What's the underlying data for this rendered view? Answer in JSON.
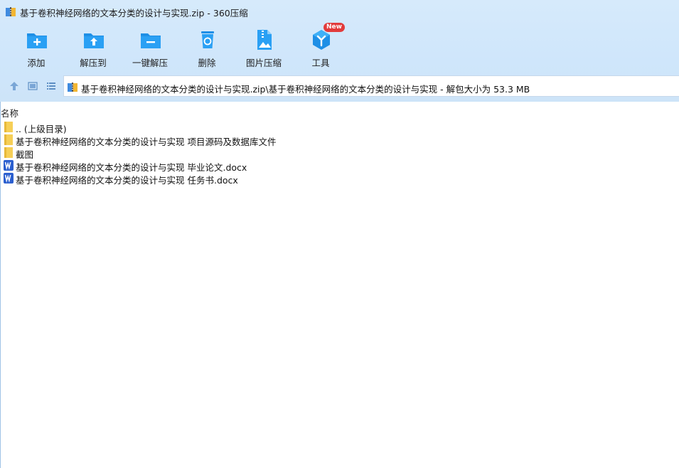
{
  "window": {
    "title": "基于卷积神经网络的文本分类的设计与实现.zip - 360压缩"
  },
  "toolbar": {
    "items": [
      {
        "label": "添加",
        "icon": "folder-plus-icon"
      },
      {
        "label": "解压到",
        "icon": "folder-upload-icon"
      },
      {
        "label": "一键解压",
        "icon": "folder-minus-icon"
      },
      {
        "label": "删除",
        "icon": "recycle-bin-icon"
      },
      {
        "label": "图片压缩",
        "icon": "image-compress-icon"
      },
      {
        "label": "工具",
        "icon": "tools-cube-icon",
        "badge": "New"
      }
    ]
  },
  "address": {
    "path": "基于卷积神经网络的文本分类的设计与实现.zip\\基于卷积神经网络的文本分类的设计与实现 - 解包大小为 53.3 MB"
  },
  "filelist": {
    "header": "名称",
    "rows": [
      {
        "name": ".. (上级目录)",
        "type": "folder"
      },
      {
        "name": "基于卷积神经网络的文本分类的设计与实现 项目源码及数据库文件",
        "type": "folder"
      },
      {
        "name": "截图",
        "type": "folder"
      },
      {
        "name": "基于卷积神经网络的文本分类的设计与实现 毕业论文.docx",
        "type": "word"
      },
      {
        "name": "基于卷积神经网络的文本分类的设计与实现 任务书.docx",
        "type": "word"
      }
    ]
  },
  "colors": {
    "accent": "#1e8fe6",
    "folder": "#f6cf57",
    "word": "#2b5fcf"
  }
}
